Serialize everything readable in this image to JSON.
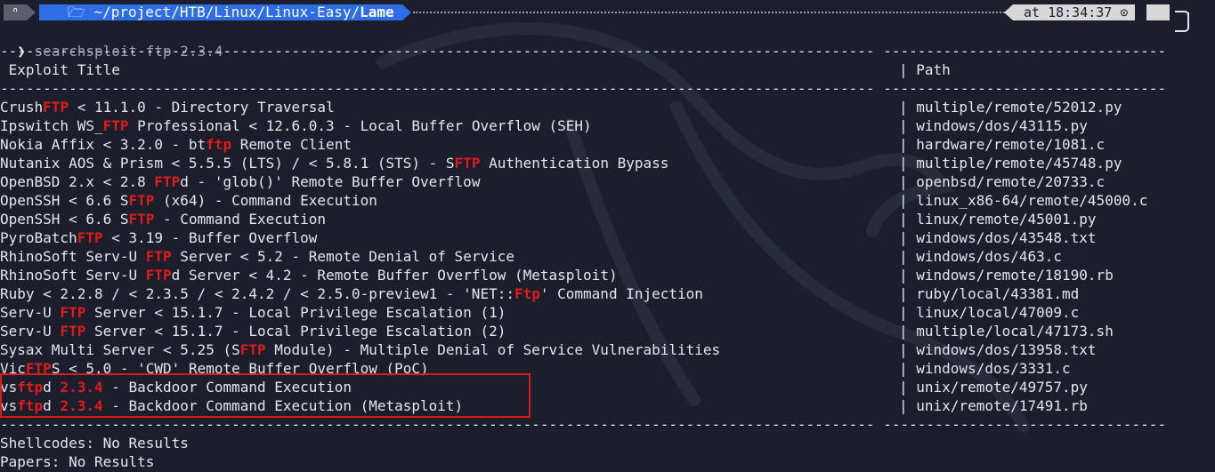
{
  "prompt": {
    "logo_glyph": "ᐢ",
    "folder_glyph": "🗁",
    "path_prefix": "~/project/HTB/Linux/Linux-Easy/",
    "path_current": "Lame",
    "time_label": "at 18:34:37",
    "clock_glyph": "⊙"
  },
  "command": {
    "chevron": "❯",
    "text": "searchsploit ftp 2.3.4"
  },
  "table": {
    "divider_left": "------------------------------------------------------------------------------------------------------",
    "divider_right": "---------------------------------",
    "header_title": " Exploit Title",
    "header_sep": "|",
    "header_path": " Path",
    "rows": [
      {
        "title": [
          [
            "Crush",
            0
          ],
          [
            "FTP",
            1
          ],
          [
            " < 11.1.0 - Directory Traversal",
            0
          ]
        ],
        "path": "multiple/remote/52012.py"
      },
      {
        "title": [
          [
            "Ipswitch WS_",
            0
          ],
          [
            "FTP",
            1
          ],
          [
            " Professional < 12.6.0.3 - Local Buffer Overflow (SEH)",
            0
          ]
        ],
        "path": "windows/dos/43115.py"
      },
      {
        "title": [
          [
            "Nokia Affix < 3.2.0 - bt",
            0
          ],
          [
            "ftp",
            1
          ],
          [
            " Remote Client",
            0
          ]
        ],
        "path": "hardware/remote/1081.c"
      },
      {
        "title": [
          [
            "Nutanix AOS & Prism < 5.5.5 (LTS) / < 5.8.1 (STS) - S",
            0
          ],
          [
            "FTP",
            1
          ],
          [
            " Authentication Bypass",
            0
          ]
        ],
        "path": "multiple/remote/45748.py"
      },
      {
        "title": [
          [
            "OpenBSD 2.x < 2.8 ",
            0
          ],
          [
            "FTP",
            1
          ],
          [
            "d - 'glob()' Remote Buffer Overflow",
            0
          ]
        ],
        "path": "openbsd/remote/20733.c"
      },
      {
        "title": [
          [
            "OpenSSH < 6.6 S",
            0
          ],
          [
            "FTP",
            1
          ],
          [
            " (x64) - Command Execution",
            0
          ]
        ],
        "path": "linux_x86-64/remote/45000.c"
      },
      {
        "title": [
          [
            "OpenSSH < 6.6 S",
            0
          ],
          [
            "FTP",
            1
          ],
          [
            " - Command Execution",
            0
          ]
        ],
        "path": "linux/remote/45001.py"
      },
      {
        "title": [
          [
            "PyroBatch",
            0
          ],
          [
            "FTP",
            1
          ],
          [
            " < 3.19 - Buffer Overflow",
            0
          ]
        ],
        "path": "windows/dos/43548.txt"
      },
      {
        "title": [
          [
            "RhinoSoft Serv-U ",
            0
          ],
          [
            "FTP",
            1
          ],
          [
            " Server < 5.2 - Remote Denial of Service",
            0
          ]
        ],
        "path": "windows/dos/463.c"
      },
      {
        "title": [
          [
            "RhinoSoft Serv-U ",
            0
          ],
          [
            "FTP",
            1
          ],
          [
            "d Server < 4.2 - Remote Buffer Overflow (Metasploit)",
            0
          ]
        ],
        "path": "windows/remote/18190.rb"
      },
      {
        "title": [
          [
            "Ruby < 2.2.8 / < 2.3.5 / < 2.4.2 / < 2.5.0-preview1 - 'NET::",
            0
          ],
          [
            "Ftp",
            1
          ],
          [
            "' Command Injection",
            0
          ]
        ],
        "path": "ruby/local/43381.md"
      },
      {
        "title": [
          [
            "Serv-U ",
            0
          ],
          [
            "FTP",
            1
          ],
          [
            " Server < 15.1.7 - Local Privilege Escalation (1)",
            0
          ]
        ],
        "path": "linux/local/47009.c"
      },
      {
        "title": [
          [
            "Serv-U ",
            0
          ],
          [
            "FTP",
            1
          ],
          [
            " Server < 15.1.7 - Local Privilege Escalation (2)",
            0
          ]
        ],
        "path": "multiple/local/47173.sh"
      },
      {
        "title": [
          [
            "Sysax Multi Server < 5.25 (S",
            0
          ],
          [
            "FTP",
            1
          ],
          [
            " Module) - Multiple Denial of Service Vulnerabilities",
            0
          ]
        ],
        "path": "windows/dos/13958.txt"
      },
      {
        "title": [
          [
            "Vic",
            0
          ],
          [
            "FTP",
            1
          ],
          [
            "S < 5.0 - 'CWD' Remote Buffer Overflow (PoC)",
            0
          ]
        ],
        "path": "windows/dos/3331.c"
      },
      {
        "title": [
          [
            "vs",
            0
          ],
          [
            "ftp",
            1
          ],
          [
            "d ",
            0
          ],
          [
            "2.3.4",
            1
          ],
          [
            " - Backdoor Command Execution",
            0
          ]
        ],
        "path": "unix/remote/49757.py"
      },
      {
        "title": [
          [
            "vs",
            0
          ],
          [
            "ftp",
            1
          ],
          [
            "d ",
            0
          ],
          [
            "2.3.4",
            1
          ],
          [
            " - Backdoor Command Execution (Metasploit)",
            0
          ]
        ],
        "path": "unix/remote/17491.rb"
      }
    ]
  },
  "results": {
    "shellcodes": "Shellcodes: No Results",
    "papers": "Papers: No Results"
  },
  "colors": {
    "background": "#1c1f2b",
    "text": "#e4e6ec",
    "match_highlight": "#e01b1b",
    "path_segment": "#2e6de8",
    "time_segment": "#d8d8d8",
    "annotation_box": "#d81b1b"
  }
}
